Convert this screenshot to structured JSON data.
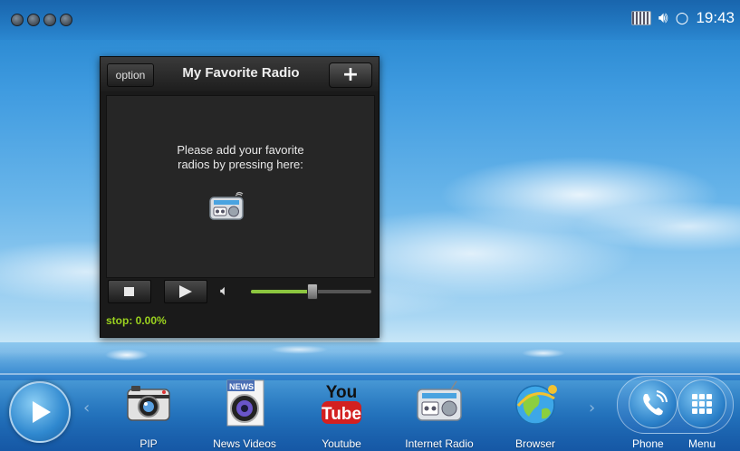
{
  "status_bar": {
    "dots_count": 4,
    "icons": [
      "keyboard-icon",
      "volume-icon",
      "sync-icon"
    ],
    "time": "19:43"
  },
  "radio_widget": {
    "option_label": "option",
    "title": "My Favorite Radio",
    "add_label": "+",
    "message": "Please add your favorite\nradios by pressing here:",
    "status": "stop: 0.00%",
    "volume_level": 0.5,
    "colors": {
      "status": "#9bd21f",
      "slider_fill": "#8cc63f"
    }
  },
  "dock": {
    "apps": [
      {
        "label": "PIP",
        "icon": "camera-icon"
      },
      {
        "label": "News Videos",
        "icon": "news-video-icon",
        "badge": "NEWS"
      },
      {
        "label": "Youtube",
        "icon": "youtube-icon",
        "line1": "You",
        "line2": "Tube"
      },
      {
        "label": "Internet Radio",
        "icon": "radio-icon"
      },
      {
        "label": "Browser",
        "icon": "globe-icon"
      }
    ],
    "phone_label": "Phone",
    "menu_label": "Menu"
  }
}
